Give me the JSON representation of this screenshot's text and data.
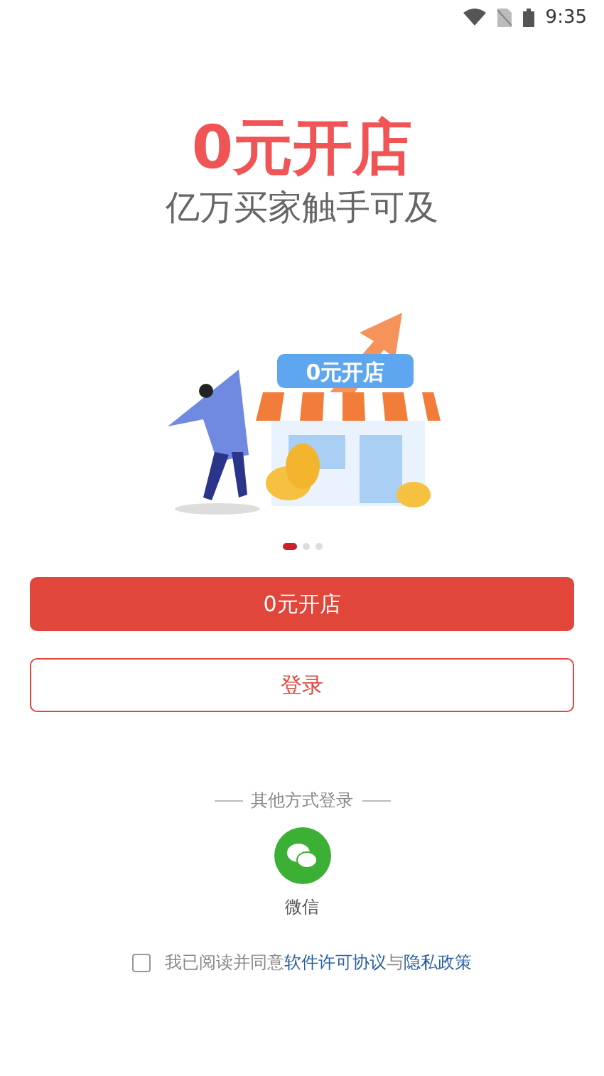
{
  "status_bar": {
    "time": "9:35"
  },
  "hero": {
    "title": "0元开店",
    "subtitle": "亿万买家触手可及"
  },
  "illustration": {
    "sign": "0元开店"
  },
  "carousel_dots": [
    {
      "selected": true
    },
    {
      "selected": false
    },
    {
      "selected": false
    }
  ],
  "buttons": [
    {
      "label": "0元开店",
      "kind": "primary"
    },
    {
      "label": "登录",
      "kind": "outline"
    }
  ],
  "other_login": {
    "heading": "其他方式登录",
    "options": [
      {
        "label": "微信"
      }
    ]
  },
  "agreement": {
    "checked": false,
    "text": "我已阅读并同意",
    "links": [
      "软件许可协议",
      "隐私政策"
    ],
    "joiner": "与"
  }
}
